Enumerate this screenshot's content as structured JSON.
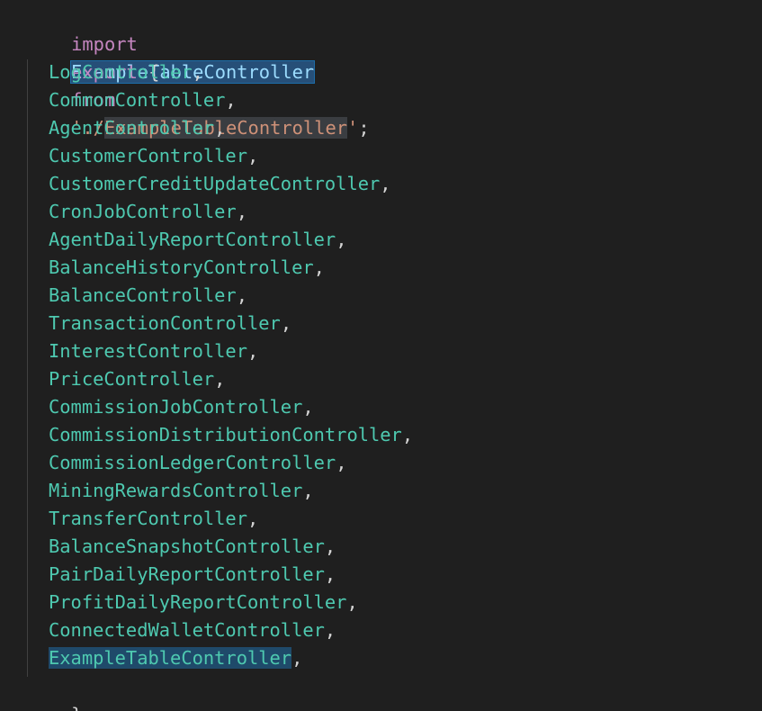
{
  "code": {
    "import_line": {
      "keyword": "import",
      "name": "ExampleTableController",
      "from": "from",
      "quote_open": "'",
      "path_prefix": "./",
      "path_name": "ExampleTableController",
      "quote_close": "'",
      "semicolon": ";"
    },
    "export_line": {
      "keyword": "export",
      "brace": "{"
    },
    "exports": [
      "LogController",
      "CommonController",
      "AgentController",
      "CustomerController",
      "CustomerCreditUpdateController",
      "CronJobController",
      "AgentDailyReportController",
      "BalanceHistoryController",
      "BalanceController",
      "TransactionController",
      "InterestController",
      "PriceController",
      "CommissionJobController",
      "CommissionDistributionController",
      "CommissionLedgerController",
      "MiningRewardsController",
      "TransferController",
      "BalanceSnapshotController",
      "PairDailyReportController",
      "ProfitDailyReportController",
      "ConnectedWalletController",
      "ExampleTableController"
    ],
    "comma": ",",
    "closing": "};"
  },
  "colors": {
    "background": "#1f1f1f",
    "keyword": "#c586c0",
    "identifier": "#4ec9b0",
    "string": "#ce9178",
    "selection": "#264f78"
  }
}
